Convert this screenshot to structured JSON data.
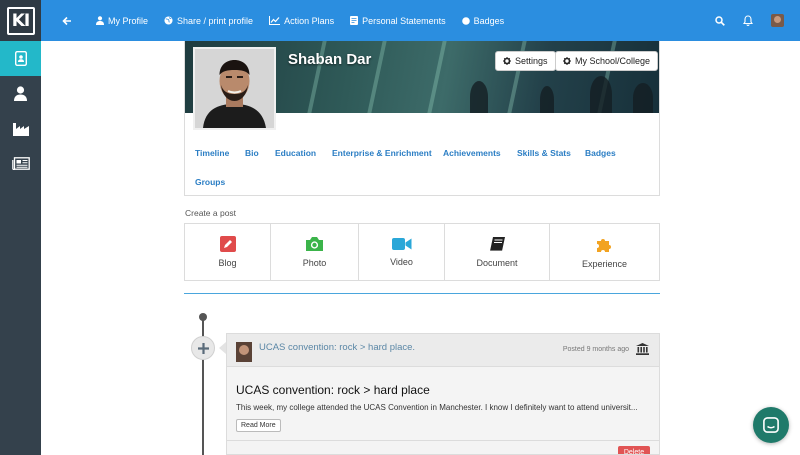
{
  "app": {
    "logo_text": "KI"
  },
  "topnav": {
    "items": [
      {
        "label": "My Profile",
        "icon": "user-icon"
      },
      {
        "label": "Share / print profile",
        "icon": "globe-icon"
      },
      {
        "label": "Action Plans",
        "icon": "line-chart-icon"
      },
      {
        "label": "Personal Statements",
        "icon": "document-icon"
      },
      {
        "label": "Badges",
        "icon": "circle-icon"
      }
    ],
    "right_icons": [
      "search-icon",
      "bell-icon",
      "user-avatar"
    ]
  },
  "sidebar": {
    "items": [
      {
        "name": "profile-card",
        "icon": "id-badge-icon",
        "active": true
      },
      {
        "name": "user",
        "icon": "user-icon",
        "active": false
      },
      {
        "name": "industry",
        "icon": "industry-icon",
        "active": false
      },
      {
        "name": "news",
        "icon": "newspaper-icon",
        "active": false
      }
    ],
    "active_color": "#23b8c9"
  },
  "profile": {
    "name": "Shaban Dar",
    "settings_label": "Settings",
    "school_label": "My School/College",
    "tabs": [
      "Timeline",
      "Bio",
      "Education",
      "Enterprise & Enrichment",
      "Achievements",
      "Skills & Stats",
      "Badges",
      "Groups"
    ]
  },
  "create_post": {
    "label": "Create a post",
    "items": [
      {
        "label": "Blog",
        "icon": "pencil-icon",
        "color": "#e04b4b"
      },
      {
        "label": "Photo",
        "icon": "camera-icon",
        "color": "#3bb44a"
      },
      {
        "label": "Video",
        "icon": "video-camera-icon",
        "color": "#2aa7d8"
      },
      {
        "label": "Document",
        "icon": "book-icon",
        "color": "#222222"
      },
      {
        "label": "Experience",
        "icon": "puzzle-icon",
        "color": "#f2a321"
      }
    ]
  },
  "post": {
    "head_title": "UCAS convention: rock > hard place.",
    "meta": "Posted 9 months ago",
    "title": "UCAS convention: rock > hard place",
    "excerpt": "This week, my college attended the UCAS Convention in Manchester. I know I definitely want to attend universit...",
    "read_more": "Read More",
    "delete_label": "Delete"
  },
  "colors": {
    "topbar": "#2b8ee0",
    "sidebar": "#34414c",
    "link": "#2b7ec4",
    "chat": "#1f7a6a"
  }
}
